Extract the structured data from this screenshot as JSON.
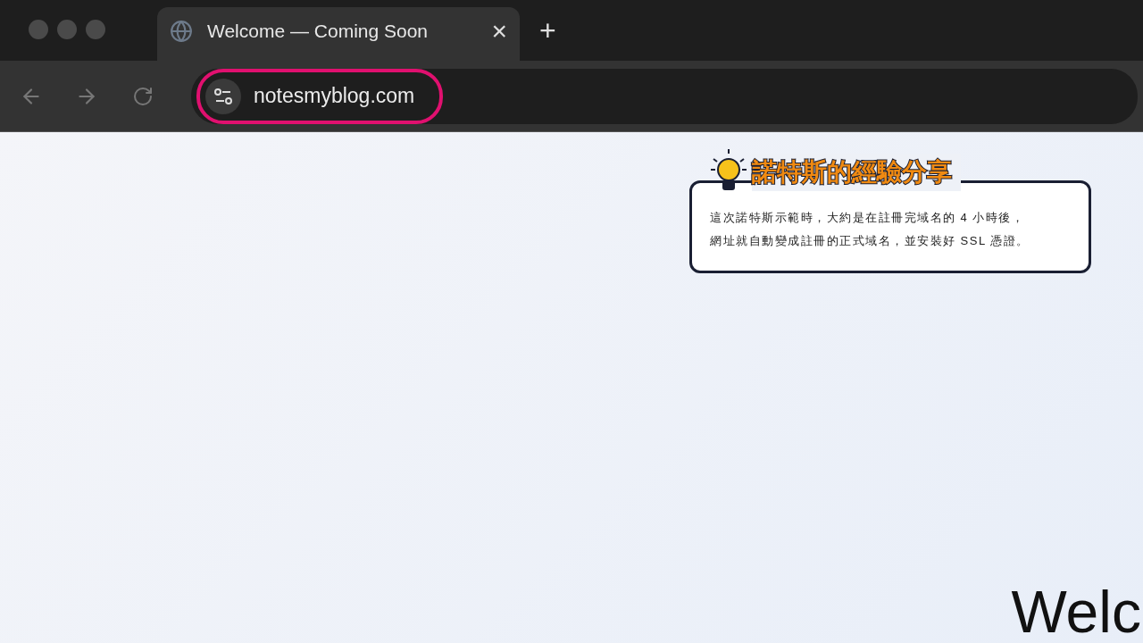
{
  "tab": {
    "title": "Welcome — Coming Soon",
    "close": "×",
    "new_tab": "+"
  },
  "address_bar": {
    "url": "notesmyblog.com",
    "highlighted": true
  },
  "callout": {
    "title": "諾特斯的經驗分享",
    "lines": [
      "這次諾特斯示範時，大約是在註冊完域名的 4 小時後，",
      "網址就自動變成註冊的正式域名，並安裝好 SSL 憑證。"
    ]
  },
  "page": {
    "heading": "Welc"
  }
}
